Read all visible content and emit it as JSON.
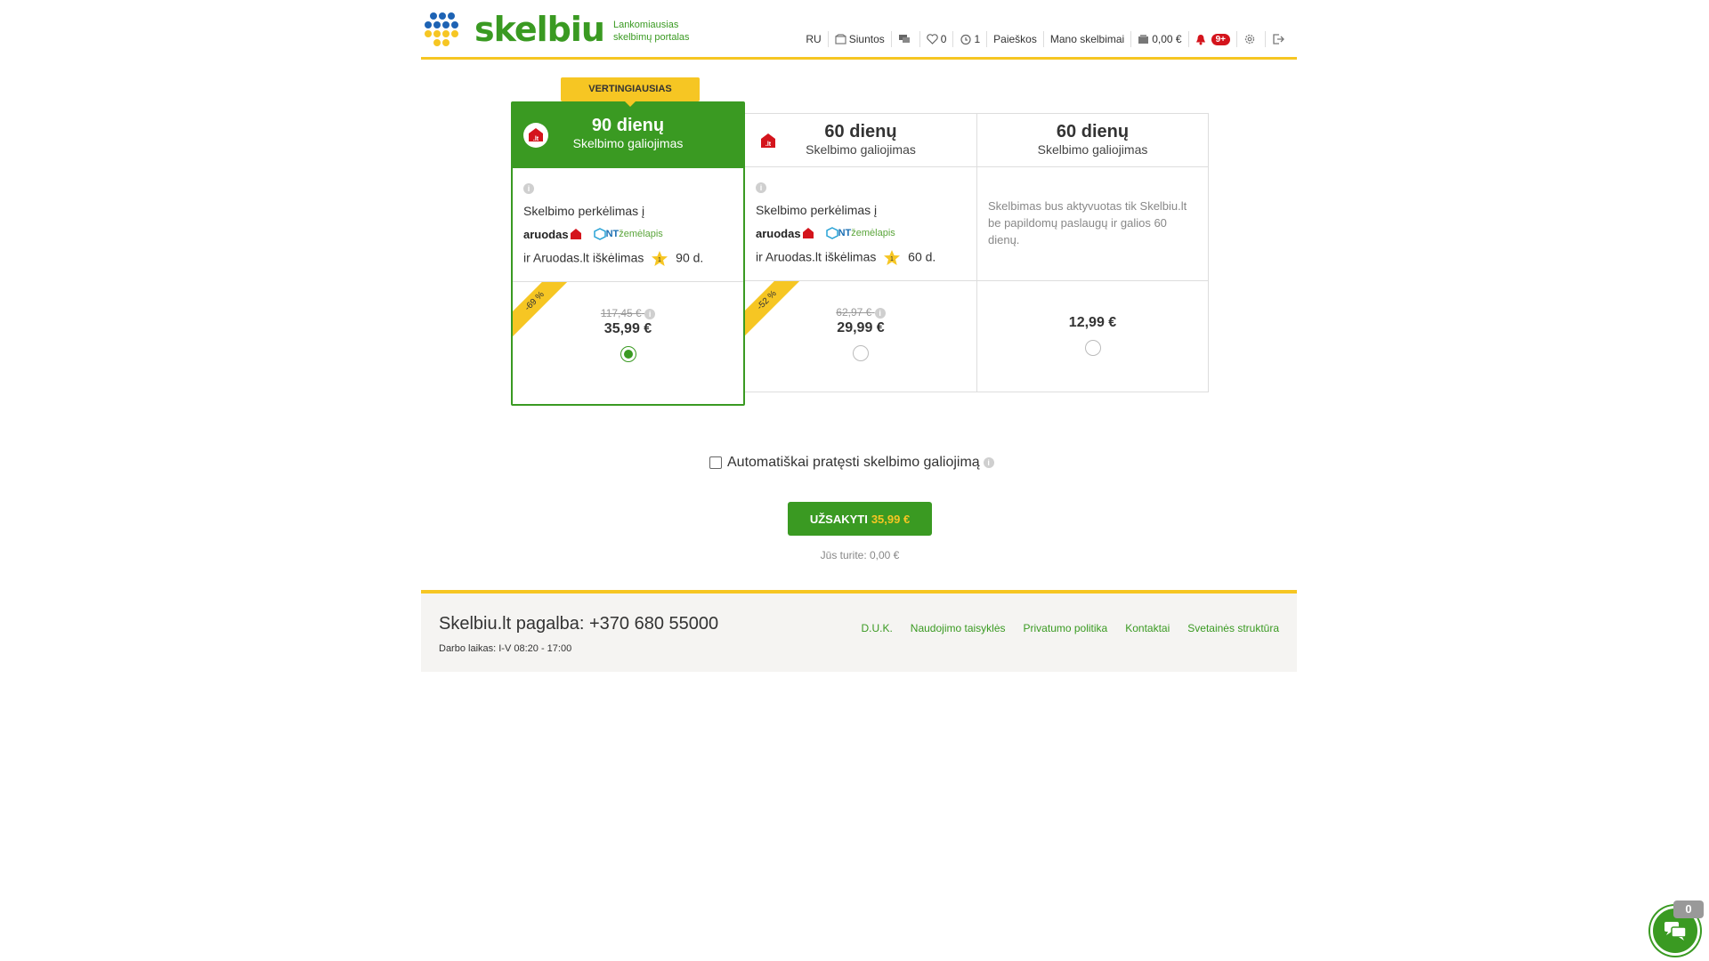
{
  "brand": {
    "name": "skelbiu",
    "tagline_line1": "Lankomiausias",
    "tagline_line2": "skelbimų portalas",
    "accent": "#3a9a22",
    "yellow": "#f6c623"
  },
  "topnav": {
    "lang": "RU",
    "shipments": "Siuntos",
    "favorites_count": "0",
    "history_count": "1",
    "searches": "Paieškos",
    "my_ads": "Mano skelbimai",
    "wallet": "0,00 €",
    "notifications": "9+"
  },
  "badge_top": "VERTINGIAUSIAS",
  "plans": [
    {
      "days": "90 dienų",
      "subtitle": "Skelbimo galiojimas",
      "transfer": "Skelbimo perkėlimas į",
      "aruodas": "aruodas",
      "nt": "NT",
      "nt_suffix": "žemėlapis",
      "promo_prefix": "ir Aruodas.lt iškėlimas",
      "promo_days": "90 d.",
      "star_num": "1",
      "discount": "-69 %",
      "old_price": "117,45 €",
      "price": "35,99 €",
      "selected": true
    },
    {
      "days": "60 dienų",
      "subtitle": "Skelbimo galiojimas",
      "transfer": "Skelbimo perkėlimas į",
      "aruodas": "aruodas",
      "nt": "NT",
      "nt_suffix": "žemėlapis",
      "promo_prefix": "ir Aruodas.lt iškėlimas",
      "promo_days": "60 d.",
      "star_num": "1",
      "discount": "-52 %",
      "old_price": "62,97 €",
      "price": "29,99 €",
      "selected": false
    },
    {
      "days": "60 dienų",
      "subtitle": "Skelbimo galiojimas",
      "description": "Skelbimas bus aktyvuotas tik Skelbiu.lt be papildomų paslaugų ir galios 60 dienų.",
      "price": "12,99 €",
      "selected": false
    }
  ],
  "auto_extend": "Automatiškai pratęsti skelbimo galiojimą",
  "order": {
    "label": "UŽSAKYTI",
    "amount": "35,99 €",
    "balance": "Jūs turite: 0,00 €"
  },
  "footer": {
    "help": "Skelbiu.lt pagalba: +370 680 55000",
    "hours": "Darbo laikas: I-V 08:20 - 17:00",
    "links": [
      "D.U.K.",
      "Naudojimo taisyklės",
      "Privatumo politika",
      "Kontaktai",
      "Svetainės struktūra"
    ]
  },
  "chat_count": "0"
}
